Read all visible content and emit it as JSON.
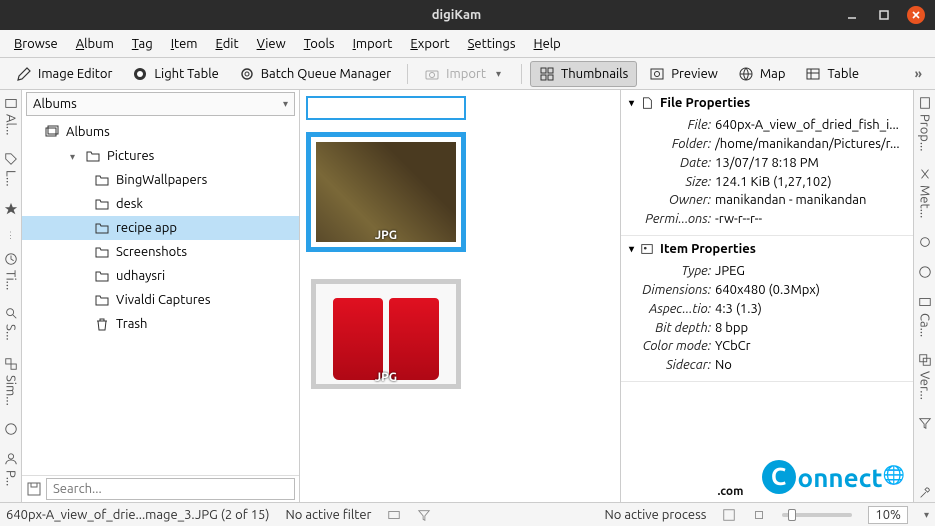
{
  "window": {
    "title": "digiKam"
  },
  "menubar": [
    "Browse",
    "Album",
    "Tag",
    "Item",
    "Edit",
    "View",
    "Tools",
    "Import",
    "Export",
    "Settings",
    "Help"
  ],
  "toolbar": {
    "image_editor": "Image Editor",
    "light_table": "Light Table",
    "batch_queue": "Batch Queue Manager",
    "import": "Import",
    "thumbnails": "Thumbnails",
    "preview": "Preview",
    "map": "Map",
    "table": "Table"
  },
  "left_rail": [
    "Al...",
    "",
    "L...",
    "",
    "Ti...",
    "S...",
    "Sim...",
    "P..."
  ],
  "right_rail": [
    "Prop...",
    "Met...",
    "",
    "Ca...",
    "Ver...",
    ""
  ],
  "sidebar": {
    "header": "Albums",
    "root": "Albums",
    "pictures": "Pictures",
    "items": [
      "BingWallpapers",
      "desk",
      "recipe app",
      "Screenshots",
      "udhaysri",
      "Vivaldi Captures"
    ],
    "selected_index": 2,
    "trash": "Trash",
    "search_placeholder": "Search..."
  },
  "thumbs": {
    "label1": "JPG",
    "label2": "JPG"
  },
  "file_props": {
    "title": "File Properties",
    "rows": [
      {
        "label": "File:",
        "value": "640px-A_view_of_dried_fish_i..."
      },
      {
        "label": "Folder:",
        "value": "/home/manikandan/Pictures/r..."
      },
      {
        "label": "Date:",
        "value": "13/07/17 8:18 PM"
      },
      {
        "label": "Size:",
        "value": "124.1 KiB (1,27,102)"
      },
      {
        "label": "Owner:",
        "value": "manikandan - manikandan"
      },
      {
        "label": "Permi...ons:",
        "value": "-rw-r--r--"
      }
    ]
  },
  "item_props": {
    "title": "Item Properties",
    "rows": [
      {
        "label": "Type:",
        "value": "JPEG"
      },
      {
        "label": "Dimensions:",
        "value": "640x480 (0.3Mpx)"
      },
      {
        "label": "Aspec...tio:",
        "value": "4:3 (1.3)"
      },
      {
        "label": "Bit depth:",
        "value": "8 bpp"
      },
      {
        "label": "Color mode:",
        "value": "YCbCr"
      },
      {
        "label": "Sidecar:",
        "value": "No"
      }
    ]
  },
  "statusbar": {
    "file": "640px-A_view_of_drie...mage_3.JPG (2 of 15)",
    "filter": "No active filter",
    "process": "No active process",
    "zoom": "10%"
  }
}
